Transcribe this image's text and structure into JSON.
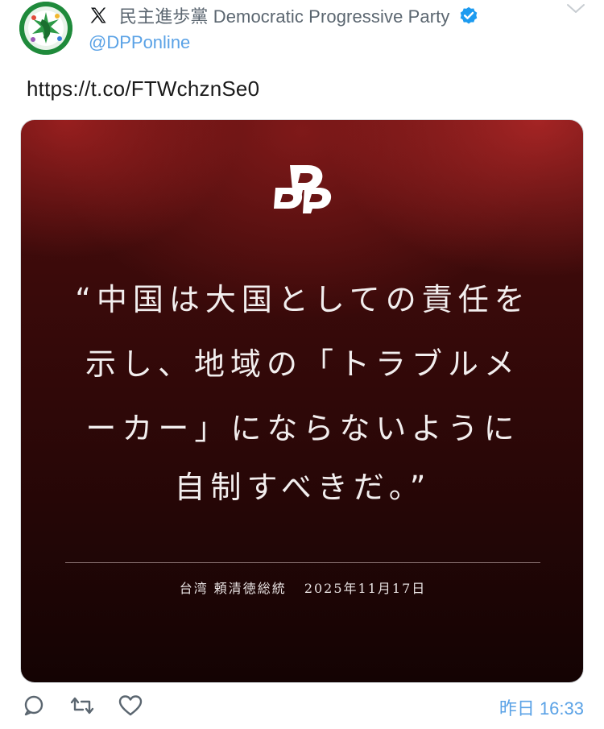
{
  "header": {
    "avatar_icon": "dpp-flag-avatar",
    "platform_icon": "x-logo-icon",
    "display_name": "民主進歩黨 Democratic Progressive Party",
    "verified_icon": "verified-badge-icon",
    "handle": "@DPPonline",
    "menu_icon": "chevron-down-icon"
  },
  "tweet": {
    "text": "https://t.co/FTWchznSe0"
  },
  "media": {
    "logo_icon": "dpp-logo",
    "quote_lines": [
      "“中国は大国としての責任を",
      "示し、地域の「トラブルメ",
      "ーカー」にならないように",
      "自制すべきだ。”"
    ],
    "attribution_name": "台湾 頼清徳総統",
    "attribution_date": "2025年11月17日",
    "colors": {
      "background_top": "#4a0d0d",
      "background_bottom": "#140303",
      "text": "#f2eeee"
    }
  },
  "footer": {
    "reply_icon": "reply-icon",
    "retweet_icon": "retweet-icon",
    "like_icon": "heart-icon",
    "timestamp": "昨日 16:33"
  },
  "colors": {
    "link": "#5aa2e6",
    "secondary_text": "#5b6670",
    "verified": "#1d9bf0"
  }
}
